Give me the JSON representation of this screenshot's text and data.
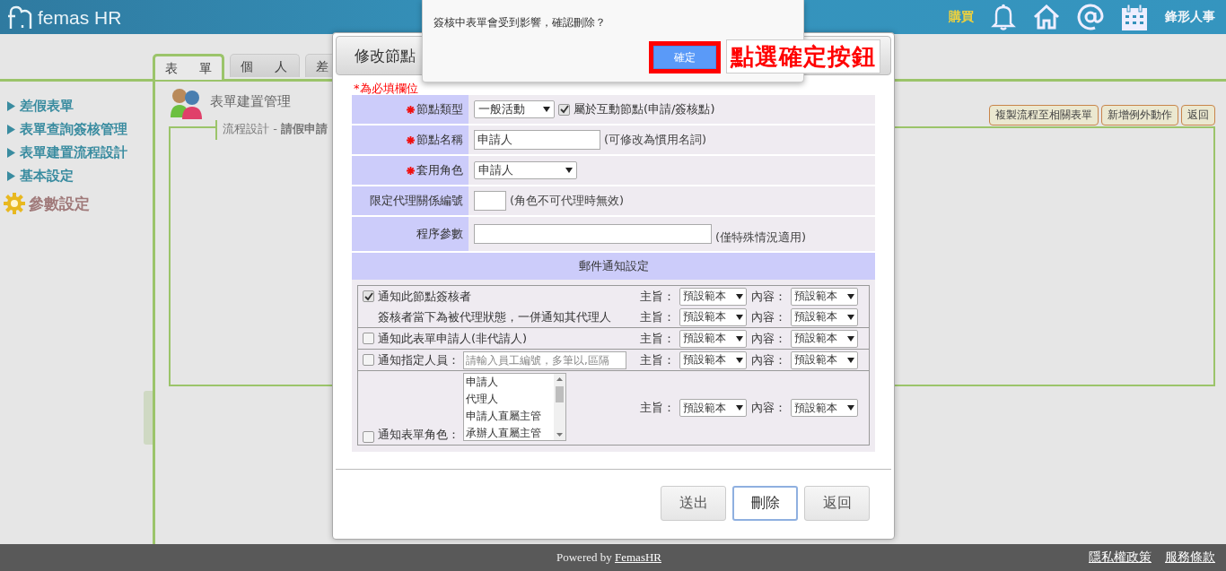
{
  "header": {
    "logo": "femas HR",
    "buy": "購買",
    "company": "鋒形人事"
  },
  "tabs": [
    {
      "label": "表 單",
      "selected": true
    },
    {
      "label": "個 人",
      "selected": false
    },
    {
      "label": "差",
      "selected": false
    }
  ],
  "sidebar": {
    "items": [
      {
        "label": "差假表單",
        "kind": "link"
      },
      {
        "label": "表單查詢簽核管理",
        "kind": "link"
      },
      {
        "label": "表單建置流程設計",
        "kind": "link"
      },
      {
        "label": "基本設定",
        "kind": "link"
      },
      {
        "label": "參數設定",
        "kind": "section"
      }
    ]
  },
  "page": {
    "title": "表單建置管理",
    "legend": "流程設計 - **請假申請**",
    "actions": [
      "複製流程至相關表單",
      "新增例外動作",
      "返回"
    ]
  },
  "modal": {
    "title": "修改節點",
    "required_note": "*為必填欄位",
    "fields": [
      {
        "label": "節點類型",
        "required": true,
        "kind": "select",
        "value": "一般活動",
        "option": {
          "label": "屬於互動節點(申請/簽核點)",
          "checked": true
        }
      },
      {
        "label": "節點名稱",
        "required": true,
        "kind": "input",
        "value": "申請人",
        "hint": "(可修改為慣用名詞)"
      },
      {
        "label": "套用角色",
        "required": true,
        "kind": "select",
        "value": "申請人"
      },
      {
        "label": "限定代理關係編號",
        "required": false,
        "kind": "short",
        "hint": "(角色不可代理時無效)"
      },
      {
        "label": "程序參數",
        "required": false,
        "kind": "textarea",
        "hint": "(僅特殊情況適用)"
      }
    ],
    "mail_section": "郵件通知設定",
    "notifications": [
      {
        "lines": [
          {
            "kind": "checkbox",
            "label": "通知此節點簽核者",
            "checked": true,
            "subject_label": "主旨：",
            "subject": "預設範本",
            "content_label": "內容：",
            "content": "預設範本"
          },
          {
            "kind": "text",
            "label": "簽核者當下為被代理狀態，一併通知其代理人",
            "subject_label": "主旨：",
            "subject": "預設範本",
            "content_label": "內容：",
            "content": "預設範本"
          }
        ]
      },
      {
        "lines": [
          {
            "kind": "checkbox",
            "label": "通知此表單申請人(非代請人)",
            "checked": false,
            "subject_label": "主旨：",
            "subject": "預設範本",
            "content_label": "內容：",
            "content": "預設範本"
          }
        ]
      },
      {
        "lines": [
          {
            "kind": "input",
            "label": "通知指定人員：",
            "checked": false,
            "placeholder": "請輸入員工編號，多筆以,區隔",
            "subject_label": "主旨：",
            "subject": "預設範本",
            "content_label": "內容：",
            "content": "預設範本"
          }
        ]
      },
      {
        "lines": [
          {
            "kind": "list",
            "label": "通知表單角色：",
            "checked": false,
            "options": [
              "申請人",
              "代理人",
              "申請人直屬主管",
              "承辦人直屬主管"
            ],
            "subject_label": "主旨：",
            "subject": "預設範本",
            "content_label": "內容：",
            "content": "預設範本"
          }
        ]
      }
    ],
    "buttons": [
      {
        "label": "送出",
        "focused": false
      },
      {
        "label": "刪除",
        "focused": true
      },
      {
        "label": "返回",
        "focused": false
      }
    ]
  },
  "confirm": {
    "message": "簽核中表單會受到影響，確認刪除？",
    "ok": "確定",
    "callout": "點選確定按鈕"
  },
  "footer": {
    "powered_by": "Powered by",
    "brand": "FemasHR",
    "links": [
      "隱私權政策",
      "服務條款"
    ]
  }
}
